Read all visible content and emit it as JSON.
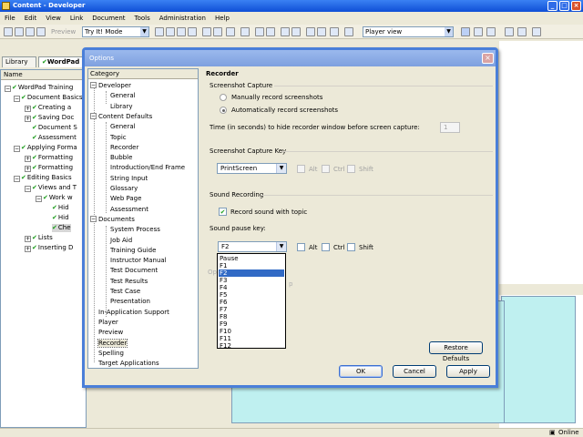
{
  "window": {
    "title": "Content - Developer",
    "menu": [
      "File",
      "Edit",
      "View",
      "Link",
      "Document",
      "Tools",
      "Administration",
      "Help"
    ]
  },
  "toolbar": {
    "preview_label": "Preview",
    "mode_value": "Try It! Mode",
    "view_value": "Player view"
  },
  "tabs": [
    "Library",
    "WordPad"
  ],
  "tree": {
    "header": "Name",
    "items": [
      "WordPad Training",
      "Document Basics",
      "Creating a",
      "Saving Doc",
      "Document S",
      "Assessment",
      "Applying Forma",
      "Formatting",
      "Formatting",
      "Editing Basics",
      "Views and T",
      "Work w",
      "Hid",
      "Hid",
      "Che",
      "Lists",
      "Inserting D"
    ]
  },
  "status": {
    "online": "Online"
  },
  "dialog": {
    "title": "Options",
    "category_header": "Category",
    "categories": [
      "Developer",
      "General",
      "Library",
      "Content Defaults",
      "General",
      "Topic",
      "Recorder",
      "Bubble",
      "Introduction/End Frame",
      "String Input",
      "Glossary",
      "Web Page",
      "Assessment",
      "Documents",
      "System Process",
      "Job Aid",
      "Training Guide",
      "Instructor Manual",
      "Test Document",
      "Test Results",
      "Test Case",
      "Presentation",
      "In-Application Support",
      "Player",
      "Preview",
      "Recorder",
      "Spelling",
      "Target Applications"
    ],
    "selected_category": "Recorder",
    "panel_title": "Recorder",
    "screenshot_capture": {
      "title": "Screenshot Capture",
      "manual": "Manually record screenshots",
      "automatic": "Automatically record screenshots",
      "hide_label": "Time (in seconds) to hide recorder window before screen capture:",
      "hide_value": "1"
    },
    "capture_key": {
      "title": "Screenshot Capture Key",
      "key": "PrintScreen",
      "alt": "Alt",
      "ctrl": "Ctrl",
      "shift": "Shift"
    },
    "sound": {
      "title": "Sound Recording",
      "record_label": "Record sound with topic",
      "pause_label": "Sound pause key:",
      "pause_key": "F2",
      "alt": "Alt",
      "ctrl": "Ctrl",
      "shift": "Shift",
      "ghost_text": "Op",
      "ghost_text2": "p"
    },
    "dropdown_options": [
      "Pause",
      "F1",
      "F2",
      "F3",
      "F4",
      "F5",
      "F6",
      "F7",
      "F8",
      "F9",
      "F10",
      "F11",
      "F12"
    ],
    "dropdown_selected": "F2",
    "buttons": {
      "restore": "Restore Defaults",
      "ok": "OK",
      "cancel": "Cancel",
      "apply": "Apply"
    }
  }
}
